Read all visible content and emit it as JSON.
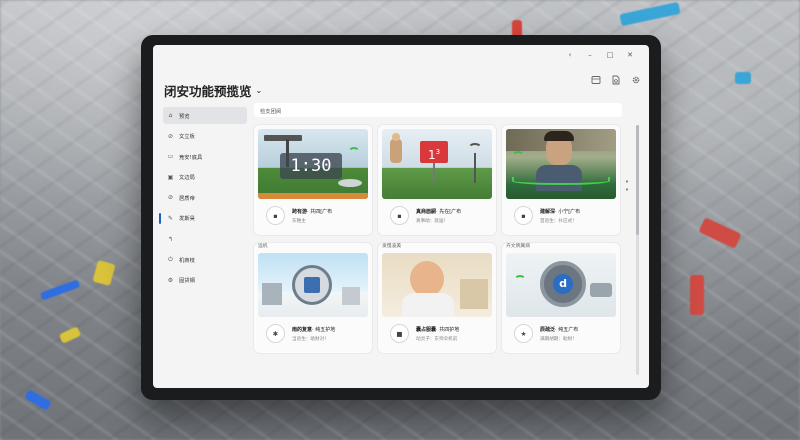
{
  "app": {
    "title": "闭安功能预揽览",
    "title_caret": "⌄"
  },
  "window_controls": {
    "back": "‹",
    "minimize": "–",
    "maximize": "□",
    "close": "✕"
  },
  "top_icons": [
    "grid-icon",
    "document-icon",
    "gear-icon"
  ],
  "sidebar": {
    "items": [
      {
        "label": "预览",
        "icon": "house-icon",
        "glyph": "⌂",
        "active": true
      },
      {
        "label": "文立板",
        "icon": "lock-icon",
        "glyph": "⊘"
      },
      {
        "label": "竞安!底具",
        "icon": "clipboard-icon",
        "glyph": "▭"
      },
      {
        "label": "文边局",
        "icon": "chat-icon",
        "glyph": "▣"
      },
      {
        "label": "居质帝",
        "icon": "link-icon",
        "glyph": "⊘"
      },
      {
        "label": "发斯昊",
        "icon": "pen-icon",
        "glyph": "✎",
        "marker": true
      },
      {
        "label": "",
        "icon": "hook-icon",
        "glyph": "↰"
      },
      {
        "label": "机商枝",
        "icon": "power-icon",
        "glyph": "⏻"
      },
      {
        "label": "固货钢",
        "icon": "settings-icon",
        "glyph": "⚙"
      }
    ]
  },
  "search": {
    "label": "检支团阅"
  },
  "scroll_dots": "•\n•",
  "cards": [
    {
      "caption": "",
      "title": "跨有游",
      "subtitle": "· 共四[广布",
      "desc": "东稚主",
      "icon": "tile-icon",
      "glyph": "▪",
      "clock": "1:30"
    },
    {
      "caption": "",
      "title": "真商面嗣",
      "subtitle": "· 先在[广布",
      "desc": "真事助：就居！",
      "icon": "tile-icon",
      "glyph": "▪",
      "sign": "1",
      "sign_sup": "3"
    },
    {
      "caption": "",
      "title": "建解深",
      "subtitle": "· 小宁[广布",
      "desc": "首验生：补应式！",
      "icon": "tile-icon",
      "glyph": "▪"
    },
    {
      "caption": "远机",
      "title": "雨的复意",
      "subtitle": "· 纯五护地",
      "desc": "当验生：助财对！",
      "icon": "puzzle-icon",
      "glyph": "✱"
    },
    {
      "caption": "发慢凌美",
      "title": "囊占服囊",
      "subtitle": "· 共四护地",
      "desc": "动灵子：东师伞机前",
      "icon": "square-icon",
      "glyph": "■"
    },
    {
      "caption": "卉文牌属病",
      "title": "辰疏泛",
      "subtitle": "· 纯五广布",
      "desc": "满期胡期：助财！",
      "icon": "star-icon",
      "glyph": "★",
      "dial": "d"
    }
  ],
  "colors": {
    "accent": "#1e5fbf",
    "green": "#32b23a",
    "bezel": "#1b1c1e",
    "screen_bg": "#f4f4f5"
  }
}
